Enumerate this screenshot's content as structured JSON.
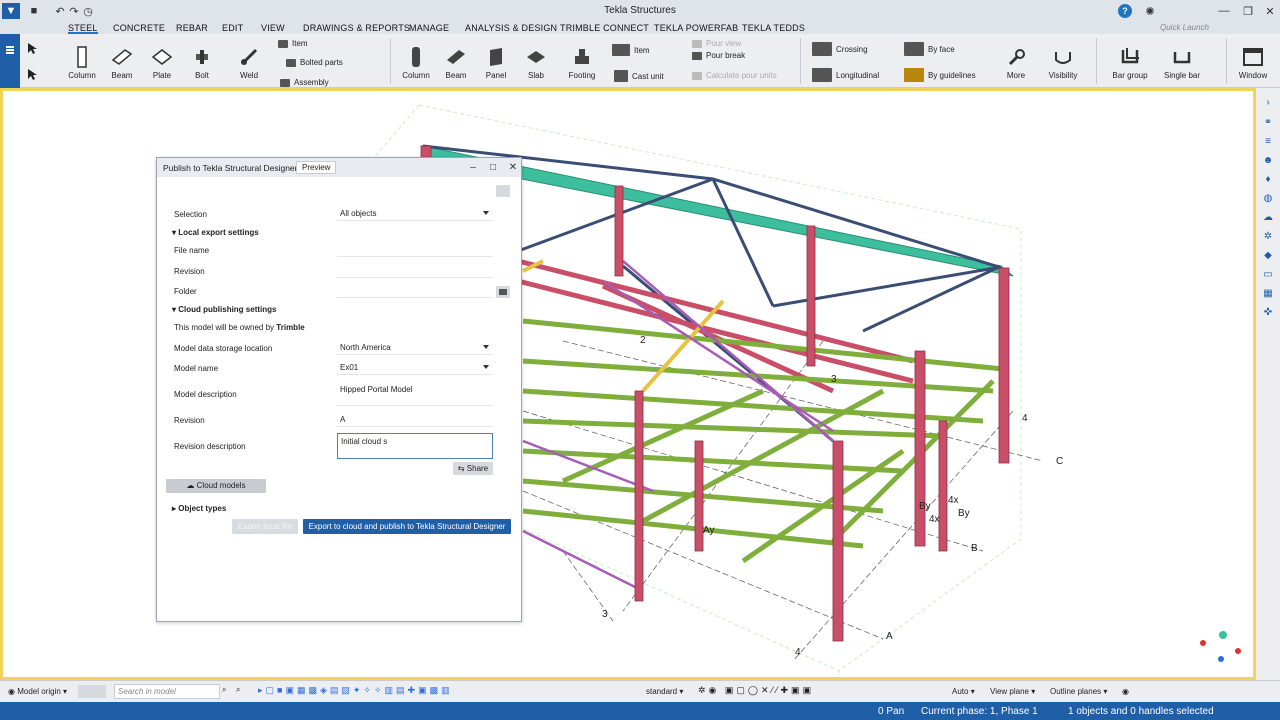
{
  "app": {
    "title": "Tekla Structures"
  },
  "menu": {
    "items": [
      "STEEL",
      "CONCRETE",
      "REBAR",
      "EDIT",
      "VIEW",
      "DRAWINGS & REPORTS",
      "MANAGE",
      "ANALYSIS & DESIGN",
      "TRIMBLE CONNECT",
      "TEKLA POWERFAB",
      "TEKLA TEDDS"
    ],
    "active": "STEEL",
    "quick_launch_placeholder": "Quick Launch"
  },
  "ribbon": {
    "steel": [
      "Column",
      "Beam",
      "Plate",
      "Bolt",
      "Weld"
    ],
    "steel_small": [
      "Item",
      "Bolted parts",
      "Assembly"
    ],
    "concrete": [
      "Column",
      "Beam",
      "Panel",
      "Slab",
      "Footing"
    ],
    "concrete_small": [
      "Item",
      "Cast unit"
    ],
    "pour": [
      "Pour view",
      "Pour break",
      "Calculate pour units"
    ],
    "rebar": [
      "Crossing",
      "Longitudinal",
      "By face",
      "By guidelines"
    ],
    "tools": [
      "More",
      "Visibility"
    ],
    "bars": [
      "Bar group",
      "Single bar"
    ],
    "window": "Window"
  },
  "dialog": {
    "title": "Publish to Tekla Structural Designer",
    "tab": "Preview",
    "selection_label": "Selection",
    "selection_value": "All objects",
    "local_section": "Local export settings",
    "file_name_label": "File name",
    "file_name_value": "",
    "revision_label": "Revision",
    "revision_value": "",
    "folder_label": "Folder",
    "folder_value": "",
    "cloud_section": "Cloud publishing settings",
    "owner_text": "This model will be owned by",
    "owner_name": "Trimble",
    "storage_label": "Model data storage location",
    "storage_value": "North America",
    "model_name_label": "Model name",
    "model_name_value": "Ex01",
    "model_desc_label": "Model description",
    "model_desc_value": "Hipped Portal Model",
    "cloud_revision_label": "Revision",
    "cloud_revision_value": "A",
    "revision_desc_label": "Revision description",
    "revision_desc_value": "Initial cloud s",
    "share_button": "Share",
    "cloud_models_button": "Cloud models",
    "object_types_section": "Object types",
    "export_local_button": "Export local file",
    "export_cloud_button": "Export to cloud and publish to Tekla Structural Designer"
  },
  "model_labels": [
    "3",
    "4",
    "C",
    "B",
    "A",
    "4",
    "3",
    "2",
    "4x",
    "By",
    "4x",
    "By",
    "Ay"
  ],
  "statusbar": {
    "model_origin": "Model origin",
    "search_placeholder": "Search in model",
    "view_mode": "standard",
    "auto_label": "Auto",
    "view_plane": "View plane",
    "outline_planes": "Outline planes",
    "pan": "0 Pan",
    "phase": "Current phase: 1, Phase 1",
    "selection": "1 objects and 0 handles selected"
  },
  "colors": {
    "accent": "#1f5fa8",
    "columns": "#c94f68",
    "beams": "#7fae3c",
    "bracing": "#3a4d74",
    "roof": "#3dbf9e",
    "viewport_border": "#f1d35a"
  }
}
